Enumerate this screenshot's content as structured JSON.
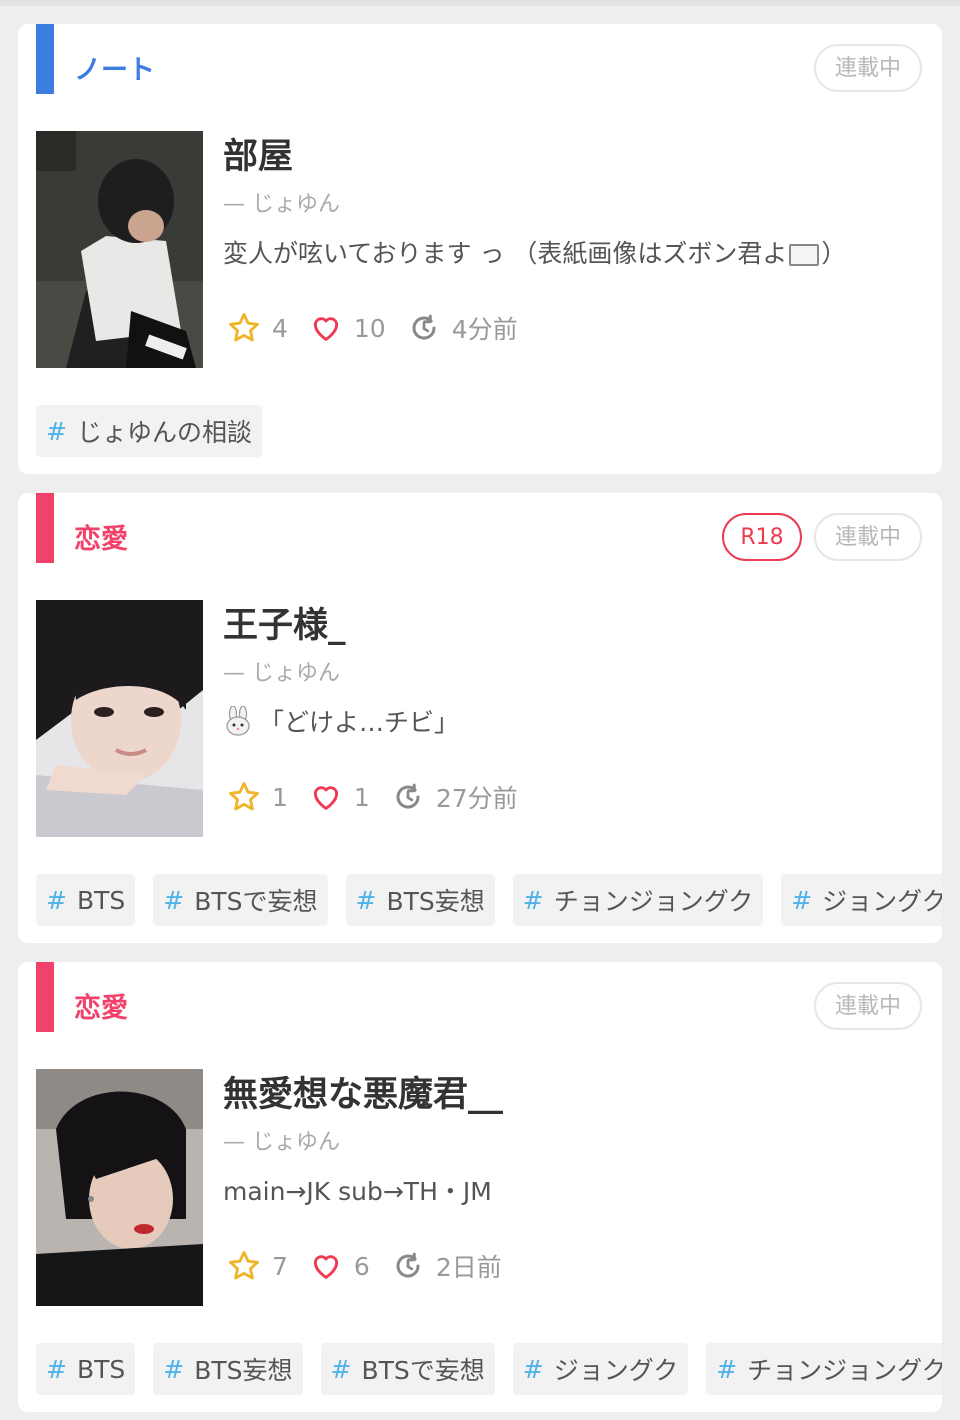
{
  "colors": {
    "note": "#3b7de0",
    "romance": "#f2416a",
    "r18": "#ee3a52",
    "tag_hash": "#4fb3e8",
    "star": "#f0b429",
    "heart": "#ee3a52"
  },
  "cards": [
    {
      "category": "ノート",
      "category_color": "#3b7de0",
      "status": "連載中",
      "title": "部屋",
      "author": "— じょゆん",
      "desc_before": "変人が呟いております っ （表紙画像はズボン君よ",
      "desc_after": "）",
      "desc_icon": "white-flag-icon",
      "stars": "4",
      "likes": "10",
      "updated": "4分前",
      "tags": [
        "じょゆんの相談"
      ]
    },
    {
      "category": "恋愛",
      "category_color": "#f2416a",
      "badge": "R18",
      "status": "連載中",
      "title": "王子様_",
      "author": "— じょゆん",
      "desc_icon": "bunny-face-icon",
      "desc": "「どけよ…チビ」",
      "stars": "1",
      "likes": "1",
      "updated": "27分前",
      "tags": [
        "BTS",
        "BTSで妄想",
        "BTS妄想",
        "チョンジョングク",
        "ジョングク"
      ]
    },
    {
      "category": "恋愛",
      "category_color": "#f2416a",
      "status": "連載中",
      "title": "無愛想な悪魔君__",
      "author": "— じょゆん",
      "desc": "main→JK sub→TH・JM",
      "stars": "7",
      "likes": "6",
      "updated": "2日前",
      "tags": [
        "BTS",
        "BTS妄想",
        "BTSで妄想",
        "ジョングク",
        "チョンジョングク"
      ]
    }
  ]
}
